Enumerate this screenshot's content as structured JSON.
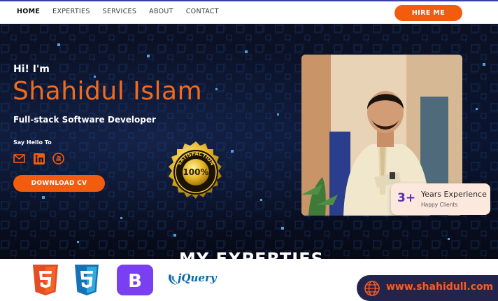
{
  "nav": {
    "items": [
      "HOME",
      "EXPERTIES",
      "SERVICES",
      "ABOUT",
      "CONTACT"
    ],
    "active": "HOME",
    "hire_label": "HIRE ME"
  },
  "hero": {
    "greeting": "Hi! I'm",
    "name": "Shahidul Islam",
    "role": "Full-stack Software Developer",
    "say_hello": "Say Hello To",
    "socials": [
      "mail-icon",
      "linkedin-icon",
      "stackoverflow-icon"
    ],
    "download_label": "DOWNLOAD CV",
    "badge_text": "100%",
    "badge_ring_text": "SATISFACTION"
  },
  "experience": {
    "number": "3+",
    "title": "Years Experience",
    "subtitle": "Happy Clients"
  },
  "section_title": "MY EXPERTIES",
  "tech_logos": [
    "html5-logo",
    "css3-logo",
    "bootstrap-logo",
    "jquery-logo"
  ],
  "jquery_label": "jQuery",
  "website": "www.shahidull.com",
  "colors": {
    "accent": "#f25c0e",
    "nav_bg": "#ffffff",
    "hero_bg": "#0a1530",
    "card_bg": "#fde8de",
    "site_bg": "#22244c"
  }
}
